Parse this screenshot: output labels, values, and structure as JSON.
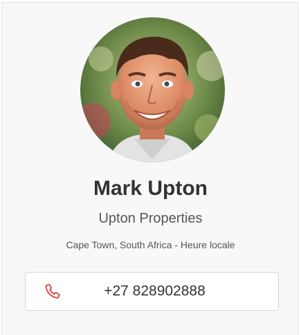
{
  "profile": {
    "avatar_icon": "person-photo",
    "name": "Mark Upton",
    "company": "Upton Properties",
    "location": "Cape Town, South Africa - Heure locale"
  },
  "contact": {
    "phone_icon": "phone-icon",
    "phone": "+27 828902888",
    "accent_color": "#d9363e"
  }
}
